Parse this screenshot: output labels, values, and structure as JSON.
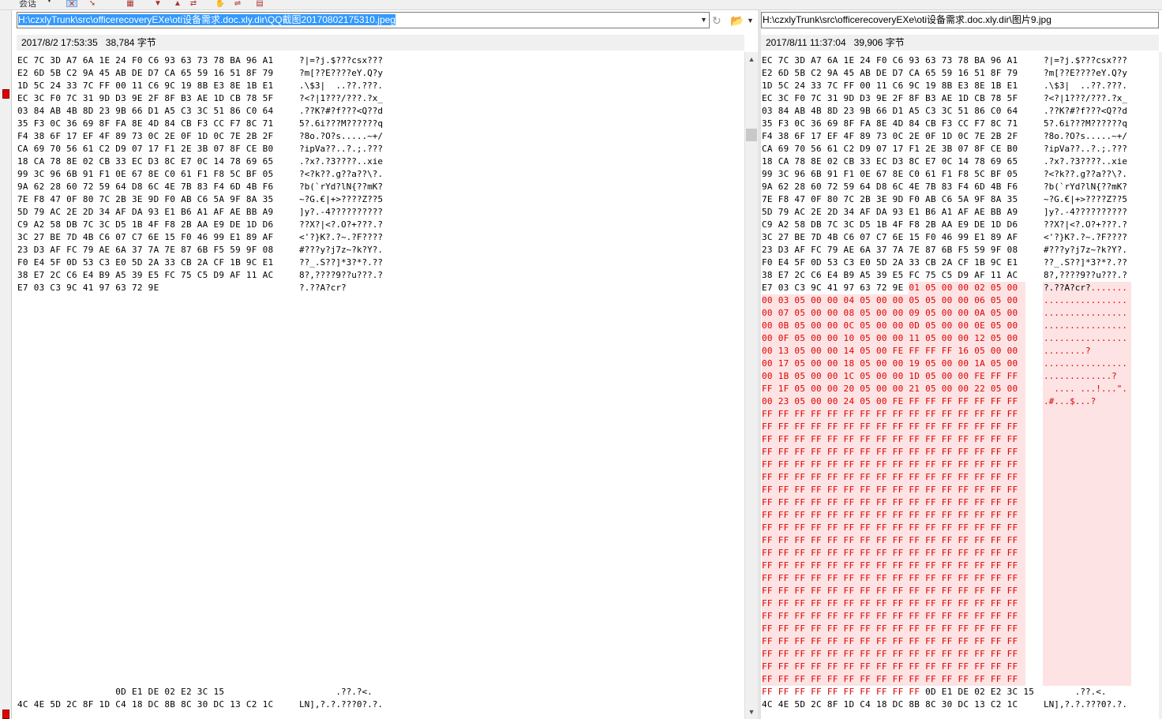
{
  "toolbar": {
    "label": "会话",
    "dropdown": "▼",
    "buttons": [
      {
        "name": "close-x-button",
        "glyph": "✕",
        "selected": true
      },
      {
        "name": "pin-red-button",
        "glyph": "➘",
        "selected": false
      },
      {
        "name": "binoculars-button",
        "glyph": "▦",
        "selected": false
      },
      {
        "name": "arrow-down-button",
        "glyph": "▼",
        "selected": false
      },
      {
        "name": "arrow-up-button",
        "glyph": "▲",
        "selected": false
      },
      {
        "name": "sync-button",
        "glyph": "⇄",
        "selected": false
      },
      {
        "name": "hand-button",
        "glyph": "✋",
        "selected": false
      },
      {
        "name": "swap-button",
        "glyph": "⇌",
        "selected": false
      },
      {
        "name": "report-button",
        "glyph": "▤",
        "selected": false
      }
    ]
  },
  "left": {
    "path": "H:\\czxlyTrunk\\src\\officerecoveryEXe\\oti设备需求.doc.xly.dir\\QQ截图20170802175310.jpeg",
    "date": "2017/8/2 17:53:35",
    "size": "38,784 字节",
    "rows": [
      {
        "hex": "EC 7C 3D A7 6A 1E 24 F0 C6 93 63 73 78 BA 96 A1",
        "ascii": "?|=?j.$???csx???"
      },
      {
        "hex": "E2 6D 5B C2 9A 45 AB DE D7 CA 65 59 16 51 8F 79",
        "ascii": "?m[??E????eY.Q?y"
      },
      {
        "hex": "1D 5C 24 33 7C FF 00 11 C6 9C 19 8B E3 8E 1B E1",
        "ascii": ".\\$3|  ..??.???."
      },
      {
        "hex": "EC 3C F0 7C 31 9D D3 9E 2F 8F B3 AE 1D CB 78 5F",
        "ascii": "?<?|1???/???.?x_"
      },
      {
        "hex": "03 84 AB 4B 8D 23 9B 66 D1 A5 C3 3C 51 86 C0 64",
        "ascii": ".??K?#?f???<Q??d"
      },
      {
        "hex": "35 F3 0C 36 69 8F FA 8E 4D 84 CB F3 CC F7 8C 71",
        "ascii": "5?.6i???M??????q"
      },
      {
        "hex": "F4 38 6F 17 EF 4F 89 73 0C 2E 0F 1D 0C 7E 2B 2F",
        "ascii": "?8o.?O?s.....~+/"
      },
      {
        "hex": "CA 69 70 56 61 C2 D9 07 17 F1 2E 3B 07 8F CE B0",
        "ascii": "?ipVa??..?.;.???"
      },
      {
        "hex": "18 CA 78 8E 02 CB 33 EC D3 8C E7 0C 14 78 69 65",
        "ascii": ".?x?.?3????..xie"
      },
      {
        "hex": "99 3C 96 6B 91 F1 0E 67 8E C0 61 F1 F8 5C BF 05",
        "ascii": "?<?k??.g??a??\\?."
      },
      {
        "hex": "9A 62 28 60 72 59 64 D8 6C 4E 7B 83 F4 6D 4B F6",
        "ascii": "?b(`rYd?lN{??mK?"
      },
      {
        "hex": "7E F8 47 0F 80 7C 2B 3E 9D F0 AB C6 5A 9F 8A 35",
        "ascii": "~?G.€|+>????Z??5"
      },
      {
        "hex": "5D 79 AC 2E 2D 34 AF DA 93 E1 B6 A1 AF AE BB A9",
        "ascii": "]y?.-4??????????"
      },
      {
        "hex": "C9 A2 58 DB 7C 3C D5 1B 4F F8 2B AA E9 DE 1D D6",
        "ascii": "??X?|<?.O?+???.?"
      },
      {
        "hex": "3C 27 BE 7D 4B C6 07 C7 6E 15 F0 46 99 E1 89 AF",
        "ascii": "<'?}K?.?~.?F????"
      },
      {
        "hex": "23 D3 AF FC 79 AE 6A 37 7A 7E 87 6B F5 59 9F 08",
        "ascii": "#???y?j7z~?k?Y?."
      },
      {
        "hex": "F0 E4 5F 0D 53 C3 E0 5D 2A 33 CB 2A CF 1B 9C E1",
        "ascii": "??_.S??]*3?*?.??"
      },
      {
        "hex": "38 E7 2C C6 E4 B9 A5 39 E5 FC 75 C5 D9 AF 11 AC",
        "ascii": "8?,????9??u???.?"
      },
      {
        "hex": "E7 03 C3 9C 41 97 63 72 9E",
        "ascii": "?.??A?cr?"
      }
    ],
    "bottom_rows": [
      {
        "hex": "                  0D E1 DE 02 E2 3C 15",
        "ascii": "       .??.?<."
      },
      {
        "hex": "4C 4E 5D 2C 8F 1D C4 18 DC 8B 8C 30 DC 13 C2 1C",
        "ascii": "LN],?.?.???0?.?."
      }
    ]
  },
  "right": {
    "path": "H:\\czxlyTrunk\\src\\officerecoveryEXe\\oti设备需求.doc.xly.dir\\图片9.jpg",
    "date": "2017/8/11 11:37:04",
    "size": "39,906 字节",
    "diff_rows": [
      {
        "hex": "00 03 05 00 00 04 05 00 00 05 05 00 00 06 05 00",
        "ascii": "................"
      },
      {
        "hex": "00 07 05 00 00 08 05 00 00 09 05 00 00 0A 05 00",
        "ascii": "................"
      },
      {
        "hex": "00 0B 05 00 00 0C 05 00 00 0D 05 00 00 0E 05 00",
        "ascii": "................"
      },
      {
        "hex": "00 0F 05 00 00 10 05 00 00 11 05 00 00 12 05 00",
        "ascii": "................"
      },
      {
        "hex": "00 13 05 00 00 14 05 00 FE FF FF FF 16 05 00 00",
        "ascii": "........?"
      },
      {
        "hex": "00 17 05 00 00 18 05 00 00 19 05 00 00 1A 05 00",
        "ascii": "................"
      },
      {
        "hex": "00 1B 05 00 00 1C 05 00 00 1D 05 00 00 FE FF FF",
        "ascii": ".............?"
      },
      {
        "hex": "FF 1F 05 00 00 20 05 00 00 21 05 00 00 22 05 00",
        "ascii": "  .... ...!...\"."
      },
      {
        "hex": "00 23 05 00 00 24 05 00 FE FF FF FF FF FF FF FF",
        "ascii": ".#...$...?"
      }
    ],
    "row19_tail": "01 05 00 00 02 05 00",
    "row19_ascii_tail": ".......",
    "ff_row": "FF FF FF FF FF FF FF FF FF FF FF FF FF FF FF FF",
    "ff_count": 22,
    "bottom_rows": [
      {
        "hex": "FF FF FF FF FF FF FF FF FF FF 0D E1 DE 02 E2 3C 15",
        "ascii": "      .??.<."
      },
      {
        "hex": "4C 4E 5D 2C 8F 1D C4 18 DC 8B 8C 30 DC 13 C2 1C",
        "ascii": "LN],?.?.???0?.?."
      }
    ]
  },
  "colors": {
    "diff_text": "#e00000",
    "diff_background": "#fde3e3",
    "path_highlight": "#3399ff"
  }
}
